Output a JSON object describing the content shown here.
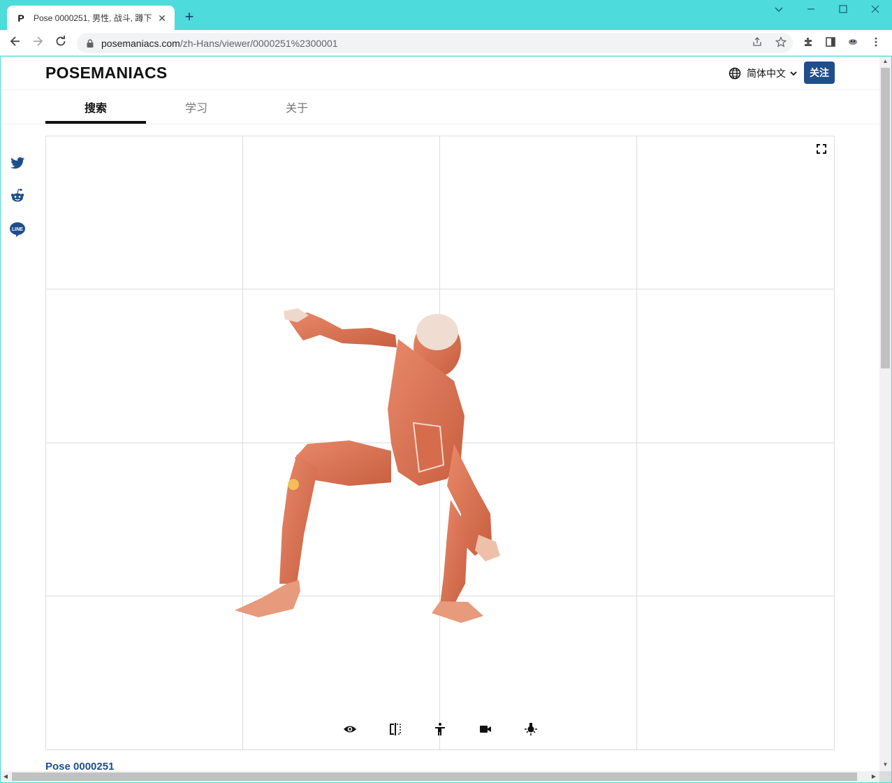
{
  "browser": {
    "tab_favicon": "P",
    "tab_title": "Pose 0000251, 男性, 战斗, 蹲下",
    "url_host": "posemaniacs.com",
    "url_path": "/zh-Hans/viewer/0000251%2300001"
  },
  "site": {
    "logo": "POSEMANIACS",
    "language": "简体中文",
    "follow_label": "关注"
  },
  "nav": {
    "tabs": [
      {
        "label": "搜索",
        "active": true
      },
      {
        "label": "学习",
        "active": false
      },
      {
        "label": "关于",
        "active": false
      }
    ]
  },
  "share": {
    "icons": [
      "twitter-icon",
      "reddit-icon",
      "line-icon"
    ],
    "line_text": "LINE"
  },
  "viewer": {
    "grid": "4x4",
    "controls": [
      "eye-icon",
      "mirror-icon",
      "pose-figure-icon",
      "camera-icon",
      "light-icon"
    ]
  },
  "pose": {
    "title": "Pose 0000251"
  },
  "colors": {
    "accent": "#1f4e8c",
    "window_frame": "#4ddbdc",
    "muscle": "#d9714f"
  }
}
